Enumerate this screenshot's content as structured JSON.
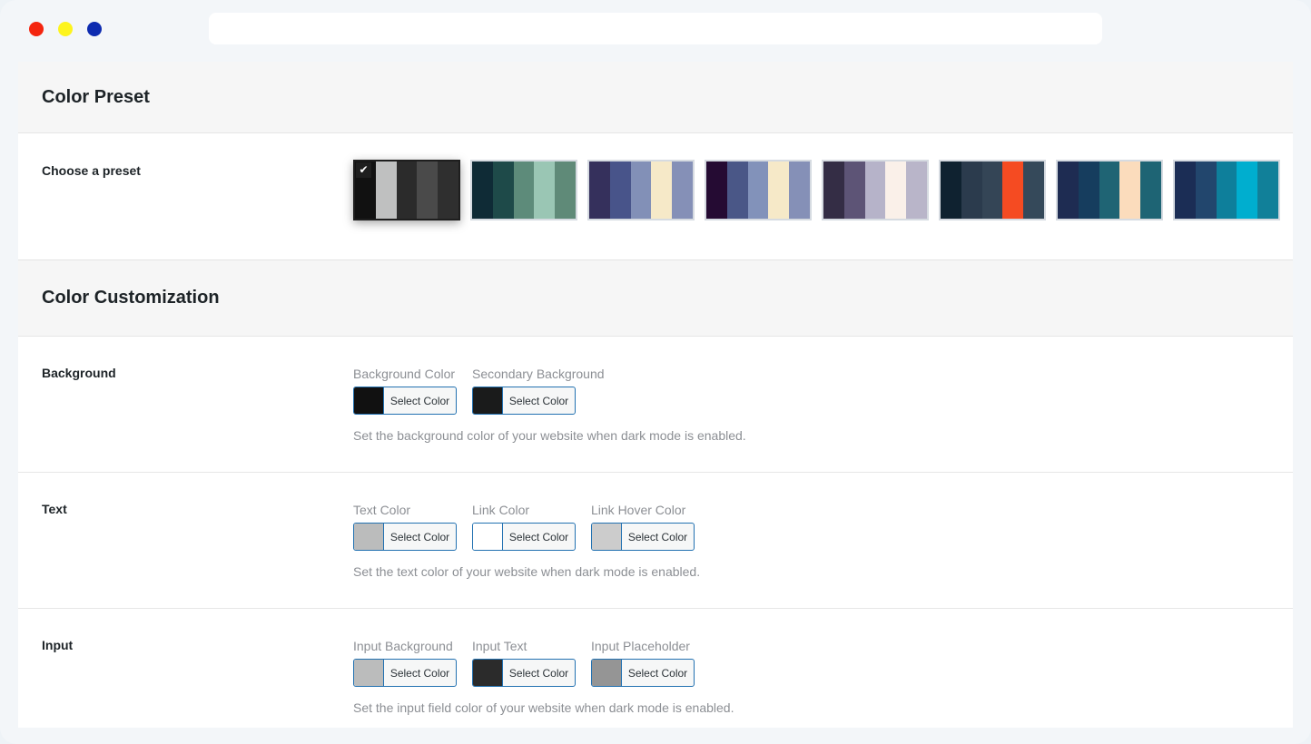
{
  "window": {
    "dots": [
      "#f4250f",
      "#fdf41d",
      "#0d2bb0"
    ]
  },
  "preset_section": {
    "title": "Color Preset",
    "label": "Choose a preset",
    "presets": [
      {
        "selected": true,
        "colors": [
          "#111111",
          "#bfc0c0",
          "#2b2b2b",
          "#4a4a4a",
          "#2f2f2f"
        ]
      },
      {
        "selected": false,
        "colors": [
          "#0f2b36",
          "#1e4a49",
          "#5d8b7a",
          "#9ac6b4",
          "#5f8a78"
        ]
      },
      {
        "selected": false,
        "colors": [
          "#35305c",
          "#48548a",
          "#8290b7",
          "#f6e9c8",
          "#8590b7"
        ]
      },
      {
        "selected": false,
        "colors": [
          "#250b33",
          "#4a5787",
          "#8292ba",
          "#f6e9c8",
          "#8590b7"
        ]
      },
      {
        "selected": false,
        "colors": [
          "#342d45",
          "#5d5476",
          "#b6b3c9",
          "#faf0e9",
          "#b9b5c9"
        ]
      },
      {
        "selected": false,
        "colors": [
          "#0f2230",
          "#2b3b4d",
          "#344556",
          "#f54b22",
          "#35495a"
        ]
      },
      {
        "selected": false,
        "colors": [
          "#1e2c52",
          "#163d5e",
          "#1f6474",
          "#fbdcbc",
          "#1e6474"
        ]
      },
      {
        "selected": false,
        "colors": [
          "#1b2d55",
          "#22466d",
          "#0e7f9b",
          "#00aecf",
          "#118099"
        ]
      }
    ]
  },
  "custom_section": {
    "title": "Color Customization",
    "button_label": "Select Color",
    "rows": [
      {
        "label": "Background",
        "fields": [
          {
            "label": "Background Color",
            "color": "#111111"
          },
          {
            "label": "Secondary Background",
            "color": "#1a1b1b"
          }
        ],
        "description": "Set the background color of your website when dark mode is enabled."
      },
      {
        "label": "Text",
        "fields": [
          {
            "label": "Text Color",
            "color": "#bbbcbc"
          },
          {
            "label": "Link Color",
            "color": "#ffffff"
          },
          {
            "label": "Link Hover Color",
            "color": "#cccccc"
          }
        ],
        "description": "Set the text color of your website when dark mode is enabled."
      },
      {
        "label": "Input",
        "fields": [
          {
            "label": "Input Background",
            "color": "#bbbcbc"
          },
          {
            "label": "Input Text",
            "color": "#2b2b2b"
          },
          {
            "label": "Input Placeholder",
            "color": "#959595"
          }
        ],
        "description": "Set the input field color of your website when dark mode is enabled."
      }
    ]
  }
}
